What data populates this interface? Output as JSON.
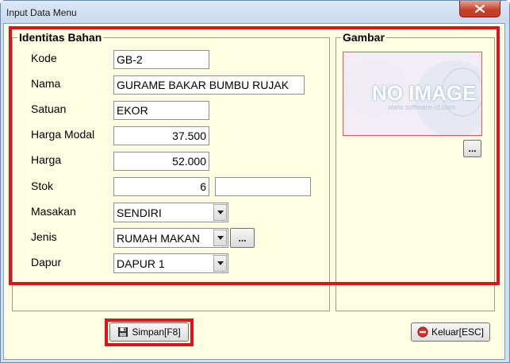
{
  "window": {
    "title": "Input Data Menu"
  },
  "identitas": {
    "title": "Identitas Bahan",
    "fields": {
      "kode": {
        "label": "Kode",
        "value": "GB-2"
      },
      "nama": {
        "label": "Nama",
        "value": "GURAME BAKAR BUMBU RUJAK"
      },
      "satuan": {
        "label": "Satuan",
        "value": "EKOR"
      },
      "harga_modal": {
        "label": "Harga Modal",
        "value": "37.500"
      },
      "harga": {
        "label": "Harga",
        "value": "52.000"
      },
      "stok": {
        "label": "Stok",
        "value": "6",
        "extra_value": ""
      },
      "masakan": {
        "label": "Masakan",
        "value": "SENDIRI"
      },
      "jenis": {
        "label": "Jenis",
        "value": "RUMAH MAKAN",
        "browse_label": "..."
      },
      "dapur": {
        "label": "Dapur",
        "value": "DAPUR 1"
      }
    }
  },
  "gambar": {
    "title": "Gambar",
    "placeholder_text": "NO IMAGE",
    "placeholder_url": "www.software-id.com",
    "browse_label": "..."
  },
  "actions": {
    "save_label": "Simpan[F8]",
    "exit_label": "Keluar[ESC]"
  },
  "colors": {
    "highlight": "#e0131c",
    "panel_bg": "#fefee3",
    "close_button": "#c8432b"
  },
  "icons": {
    "close": "close-icon",
    "save": "floppy-disk-icon",
    "exit": "no-entry-icon",
    "dropdown": "chevron-down-icon"
  }
}
